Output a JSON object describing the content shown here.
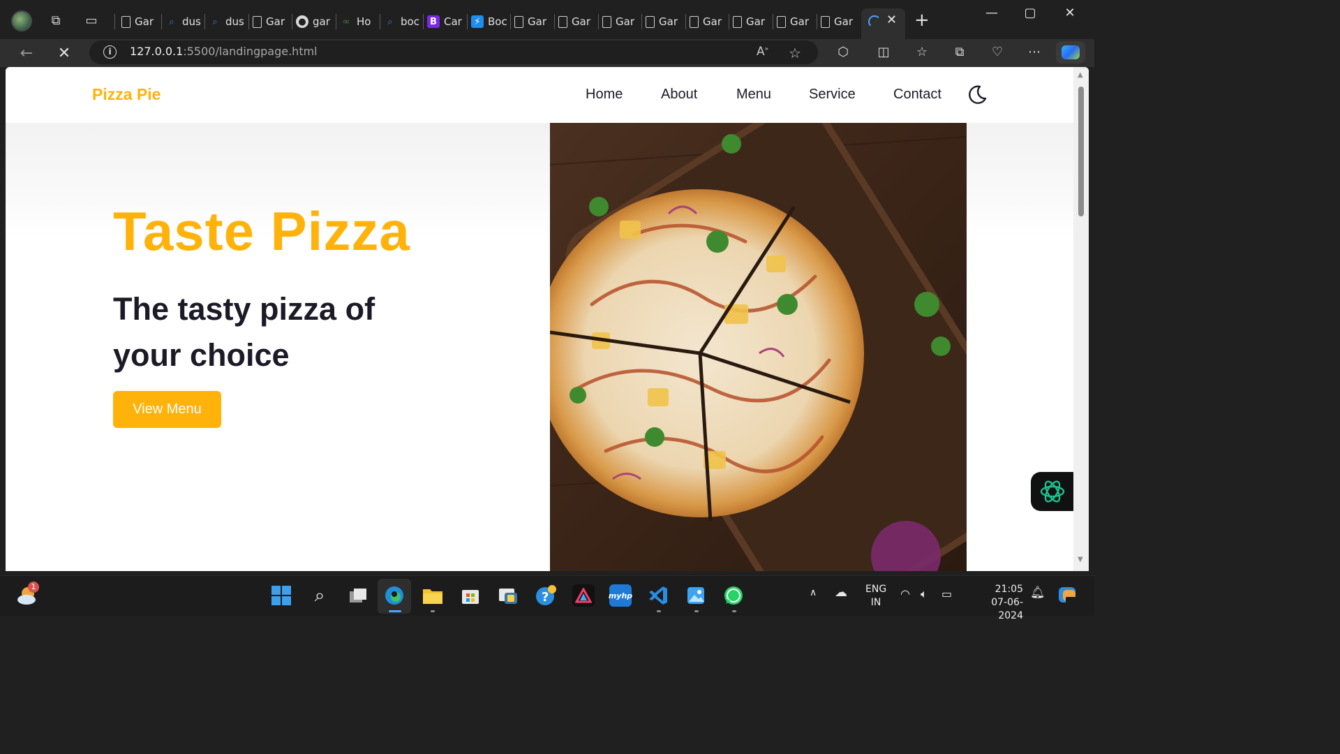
{
  "browser": {
    "tabs": [
      {
        "label": "Gar",
        "icon": "document-icon"
      },
      {
        "label": "dus",
        "icon": "search-icon"
      },
      {
        "label": "dus",
        "icon": "search-icon"
      },
      {
        "label": "Gar",
        "icon": "document-icon"
      },
      {
        "label": "gar",
        "icon": "github-icon"
      },
      {
        "label": "Ho",
        "icon": "green-link-icon"
      },
      {
        "label": "boc",
        "icon": "search-icon"
      },
      {
        "label": "Car",
        "icon": "bootstrap-icon"
      },
      {
        "label": "Boc",
        "icon": "bolt-icon"
      },
      {
        "label": "Gar",
        "icon": "document-icon"
      },
      {
        "label": "Gar",
        "icon": "document-icon"
      },
      {
        "label": "Gar",
        "icon": "document-icon"
      },
      {
        "label": "Gar",
        "icon": "document-icon"
      },
      {
        "label": "Gar",
        "icon": "document-icon"
      },
      {
        "label": "Gar",
        "icon": "document-icon"
      },
      {
        "label": "Gar",
        "icon": "document-icon"
      },
      {
        "label": "Gar",
        "icon": "document-icon"
      }
    ],
    "address": {
      "host": "127.0.0.1",
      "path": ":5500/landingpage.html"
    }
  },
  "site": {
    "logo": "Pizza Pie",
    "nav": [
      "Home",
      "About",
      "Menu",
      "Service",
      "Contact"
    ],
    "hero": {
      "title": "Taste Pizza",
      "subtitle": "The tasty pizza of your choice",
      "button": "View Menu"
    }
  },
  "taskbar": {
    "notification_count": "1",
    "language": [
      "ENG",
      "IN"
    ],
    "time": "21:05",
    "date": "07-06-2024"
  },
  "colors": {
    "accent": "#ffb20a",
    "text_dark": "#1c1a26",
    "browser_bg": "#202020"
  }
}
